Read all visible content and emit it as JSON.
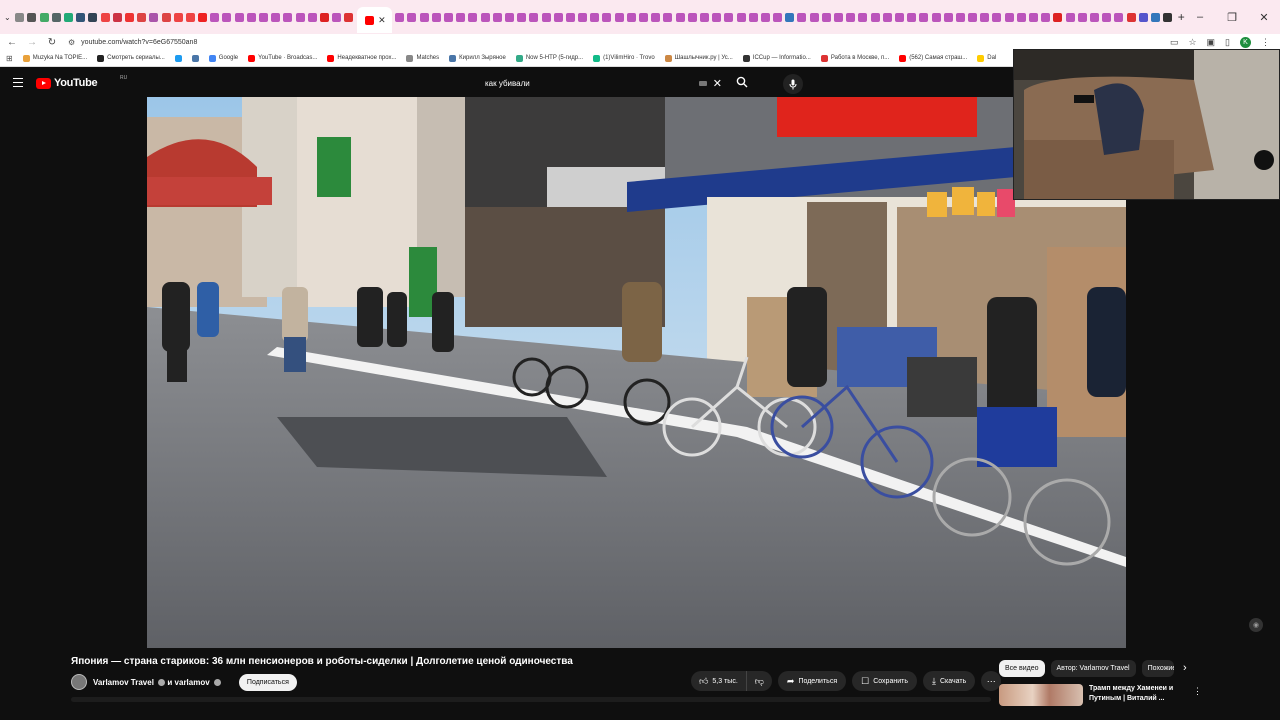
{
  "browser": {
    "tab_colors": [
      "#888",
      "#555",
      "#4a6",
      "#566",
      "#2a7",
      "#357",
      "#345",
      "#e44",
      "#c34",
      "#e33",
      "#d44",
      "#a5a",
      "#d44",
      "#e44",
      "#e44",
      "#e22",
      "#b5b",
      "#b5b",
      "#b5b",
      "#b5b",
      "#b5b",
      "#b5b",
      "#b5b",
      "#b5b",
      "#b5b",
      "#d22",
      "#b5b",
      "#d33"
    ],
    "tab_colors_right": [
      "#b5b",
      "#b5b",
      "#b5b",
      "#b5b",
      "#b5b",
      "#b5b",
      "#b5b",
      "#b5b",
      "#b5b",
      "#b5b",
      "#b5b",
      "#b5b",
      "#b5b",
      "#b5b",
      "#b5b",
      "#b5b",
      "#b5b",
      "#b5b",
      "#b5b",
      "#b5b",
      "#b5b",
      "#b5b",
      "#b5b",
      "#b5b",
      "#b5b",
      "#b5b",
      "#b5b",
      "#b5b",
      "#b5b",
      "#b5b",
      "#b5b",
      "#b5b",
      "#37b",
      "#b5b",
      "#b5b",
      "#b5b",
      "#b5b",
      "#b5b",
      "#b5b",
      "#b5b",
      "#b5b",
      "#b5b",
      "#b5b",
      "#b5b",
      "#b5b",
      "#b5b",
      "#b5b",
      "#b5b",
      "#b5b",
      "#b5b",
      "#b5b",
      "#b5b",
      "#b5b",
      "#b5b",
      "#d22",
      "#b5b",
      "#b5b",
      "#b5b",
      "#b5b",
      "#b5b",
      "#d33",
      "#55c",
      "#37b",
      "#333",
      "#333",
      "#333",
      "#333",
      "#2a5",
      "#333",
      "#555",
      "#d33",
      "#4c8",
      "#57c"
    ],
    "window_controls": [
      "–",
      "❐",
      "✕"
    ],
    "url": "youtube.com/watch?v=6eG67550an8",
    "bookmarks": [
      {
        "label": "Muzyka Na TOPIE...",
        "color": "#e9a13b"
      },
      {
        "label": "Смотреть сериалы...",
        "color": "#222"
      },
      {
        "label": "",
        "color": "#1d9bf0"
      },
      {
        "label": "",
        "color": "#4a76a8"
      },
      {
        "label": "Google",
        "color": "#4285f4"
      },
      {
        "label": "YouTube · Broadcas...",
        "color": "#f00"
      },
      {
        "label": "Неадекватное прох...",
        "color": "#f00"
      },
      {
        "label": "Matches",
        "color": "#888"
      },
      {
        "label": "Кирилл Зыряное",
        "color": "#4a76a8"
      },
      {
        "label": "Now 5-HTP (5-гидр...",
        "color": "#3a8"
      },
      {
        "label": "(1)VilimHiro · Trovo",
        "color": "#1b8"
      },
      {
        "label": "Шашлычник.ру | Ус...",
        "color": "#c84"
      },
      {
        "label": "ICCup — Informatio...",
        "color": "#333"
      },
      {
        "label": "Работа в Москве, п...",
        "color": "#d33"
      },
      {
        "label": "(562) Самая страш...",
        "color": "#f00"
      },
      {
        "label": "Dal",
        "color": "#fc0"
      }
    ]
  },
  "youtube": {
    "logo_text": "YouTube",
    "region": "RU",
    "search_value": "как убивали",
    "video": {
      "title": "Япония — страна стариков: 36 млн пенсионеров и роботы-сиделки | Долголетие ценой одиночества",
      "channel": "Varlamov Travel",
      "channel_suffix": "и varlamov",
      "subscribe_label": "Подписаться",
      "likes": "5,3 тыс.",
      "share_label": "Поделиться",
      "save_label": "Сохранить",
      "download_label": "Скачать"
    },
    "chips": [
      "Все видео",
      "Автор: Varlamov Travel",
      "Похожие"
    ],
    "recommendation": {
      "title": "Трамп между Хаменеи и Путиным | Виталий ..."
    }
  }
}
